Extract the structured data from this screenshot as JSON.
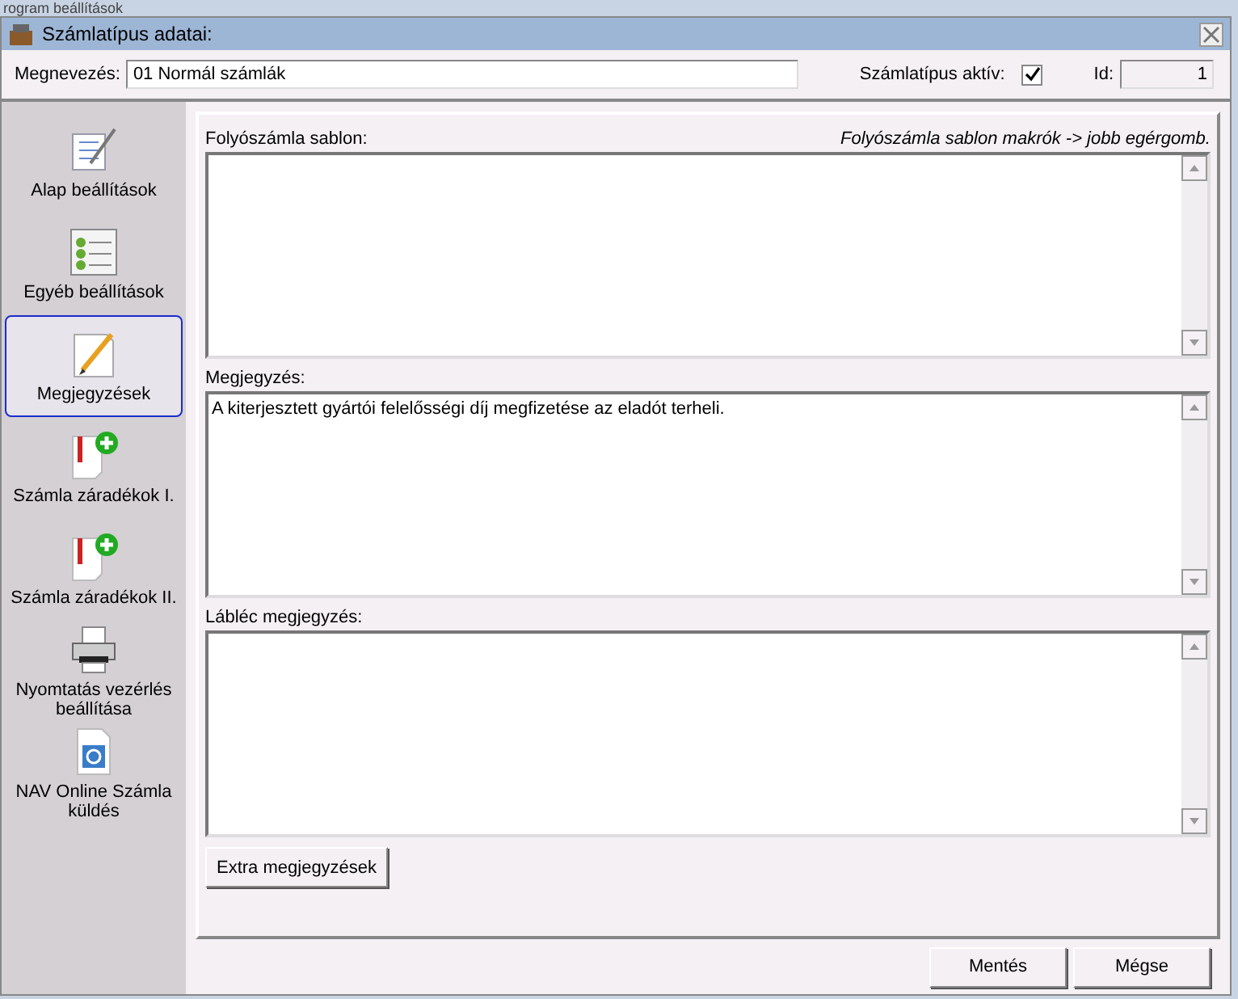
{
  "background_window": {
    "title": "rogram beállítások"
  },
  "window": {
    "title": "Számlatípus adatai:"
  },
  "name_field": {
    "label": "Megnevezés:",
    "value": "01 Normál számlák"
  },
  "active_checkbox": {
    "label": "Számlatípus aktív:",
    "checked": true
  },
  "id_field": {
    "label": "Id:",
    "value": "1"
  },
  "sidebar": {
    "items": [
      {
        "label": "Alap beállítások",
        "kind": "checklist",
        "selected": false
      },
      {
        "label": "Egyéb beállítások",
        "kind": "list",
        "selected": false
      },
      {
        "label": "Megjegyzések",
        "kind": "pencil",
        "selected": true
      },
      {
        "label": "Számla záradékok I.",
        "kind": "addnote",
        "selected": false
      },
      {
        "label": "Számla záradékok II.",
        "kind": "addnote",
        "selected": false
      },
      {
        "label": "Nyomtatás vezérlés beállítása",
        "kind": "printer",
        "selected": false
      },
      {
        "label": "NAV Online Számla küldés",
        "kind": "document",
        "selected": false
      }
    ]
  },
  "template_hint": "Folyószámla sablon makrók -> jobb egérgomb.",
  "text_areas": [
    {
      "label": "Folyószámla sablon:"
    },
    {
      "label": "Megjegyzés:",
      "value": "A kiterjesztett gyártói felelősségi díj megfizetése az eladót terheli."
    },
    {
      "label": "Lábléc megjegyzés:"
    }
  ],
  "extra_button": "Extra megjegyzések",
  "buttons": [
    "Mentés",
    "Mégse"
  ]
}
